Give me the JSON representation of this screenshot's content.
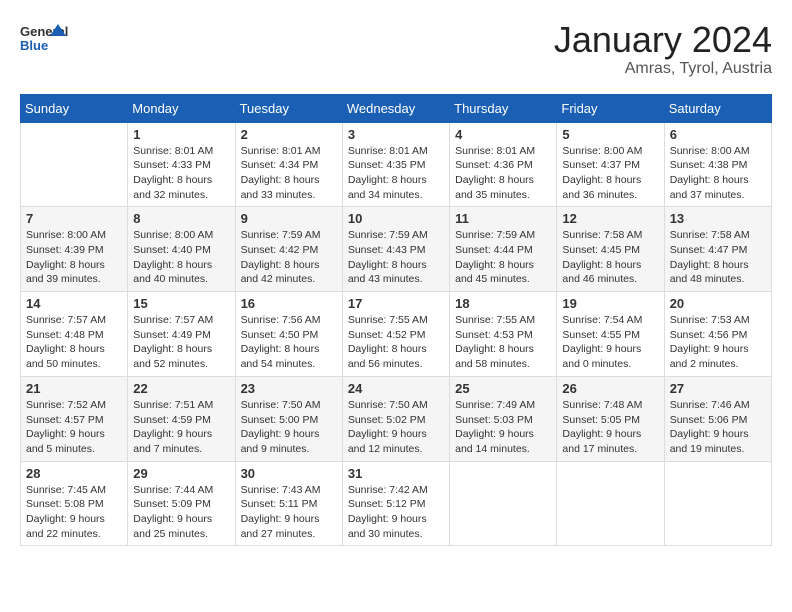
{
  "header": {
    "logo_general": "General",
    "logo_blue": "Blue",
    "title": "January 2024",
    "location": "Amras, Tyrol, Austria"
  },
  "weekdays": [
    "Sunday",
    "Monday",
    "Tuesday",
    "Wednesday",
    "Thursday",
    "Friday",
    "Saturday"
  ],
  "weeks": [
    [
      {
        "day": "",
        "info": ""
      },
      {
        "day": "1",
        "info": "Sunrise: 8:01 AM\nSunset: 4:33 PM\nDaylight: 8 hours\nand 32 minutes."
      },
      {
        "day": "2",
        "info": "Sunrise: 8:01 AM\nSunset: 4:34 PM\nDaylight: 8 hours\nand 33 minutes."
      },
      {
        "day": "3",
        "info": "Sunrise: 8:01 AM\nSunset: 4:35 PM\nDaylight: 8 hours\nand 34 minutes."
      },
      {
        "day": "4",
        "info": "Sunrise: 8:01 AM\nSunset: 4:36 PM\nDaylight: 8 hours\nand 35 minutes."
      },
      {
        "day": "5",
        "info": "Sunrise: 8:00 AM\nSunset: 4:37 PM\nDaylight: 8 hours\nand 36 minutes."
      },
      {
        "day": "6",
        "info": "Sunrise: 8:00 AM\nSunset: 4:38 PM\nDaylight: 8 hours\nand 37 minutes."
      }
    ],
    [
      {
        "day": "7",
        "info": "Sunrise: 8:00 AM\nSunset: 4:39 PM\nDaylight: 8 hours\nand 39 minutes."
      },
      {
        "day": "8",
        "info": "Sunrise: 8:00 AM\nSunset: 4:40 PM\nDaylight: 8 hours\nand 40 minutes."
      },
      {
        "day": "9",
        "info": "Sunrise: 7:59 AM\nSunset: 4:42 PM\nDaylight: 8 hours\nand 42 minutes."
      },
      {
        "day": "10",
        "info": "Sunrise: 7:59 AM\nSunset: 4:43 PM\nDaylight: 8 hours\nand 43 minutes."
      },
      {
        "day": "11",
        "info": "Sunrise: 7:59 AM\nSunset: 4:44 PM\nDaylight: 8 hours\nand 45 minutes."
      },
      {
        "day": "12",
        "info": "Sunrise: 7:58 AM\nSunset: 4:45 PM\nDaylight: 8 hours\nand 46 minutes."
      },
      {
        "day": "13",
        "info": "Sunrise: 7:58 AM\nSunset: 4:47 PM\nDaylight: 8 hours\nand 48 minutes."
      }
    ],
    [
      {
        "day": "14",
        "info": "Sunrise: 7:57 AM\nSunset: 4:48 PM\nDaylight: 8 hours\nand 50 minutes."
      },
      {
        "day": "15",
        "info": "Sunrise: 7:57 AM\nSunset: 4:49 PM\nDaylight: 8 hours\nand 52 minutes."
      },
      {
        "day": "16",
        "info": "Sunrise: 7:56 AM\nSunset: 4:50 PM\nDaylight: 8 hours\nand 54 minutes."
      },
      {
        "day": "17",
        "info": "Sunrise: 7:55 AM\nSunset: 4:52 PM\nDaylight: 8 hours\nand 56 minutes."
      },
      {
        "day": "18",
        "info": "Sunrise: 7:55 AM\nSunset: 4:53 PM\nDaylight: 8 hours\nand 58 minutes."
      },
      {
        "day": "19",
        "info": "Sunrise: 7:54 AM\nSunset: 4:55 PM\nDaylight: 9 hours\nand 0 minutes."
      },
      {
        "day": "20",
        "info": "Sunrise: 7:53 AM\nSunset: 4:56 PM\nDaylight: 9 hours\nand 2 minutes."
      }
    ],
    [
      {
        "day": "21",
        "info": "Sunrise: 7:52 AM\nSunset: 4:57 PM\nDaylight: 9 hours\nand 5 minutes."
      },
      {
        "day": "22",
        "info": "Sunrise: 7:51 AM\nSunset: 4:59 PM\nDaylight: 9 hours\nand 7 minutes."
      },
      {
        "day": "23",
        "info": "Sunrise: 7:50 AM\nSunset: 5:00 PM\nDaylight: 9 hours\nand 9 minutes."
      },
      {
        "day": "24",
        "info": "Sunrise: 7:50 AM\nSunset: 5:02 PM\nDaylight: 9 hours\nand 12 minutes."
      },
      {
        "day": "25",
        "info": "Sunrise: 7:49 AM\nSunset: 5:03 PM\nDaylight: 9 hours\nand 14 minutes."
      },
      {
        "day": "26",
        "info": "Sunrise: 7:48 AM\nSunset: 5:05 PM\nDaylight: 9 hours\nand 17 minutes."
      },
      {
        "day": "27",
        "info": "Sunrise: 7:46 AM\nSunset: 5:06 PM\nDaylight: 9 hours\nand 19 minutes."
      }
    ],
    [
      {
        "day": "28",
        "info": "Sunrise: 7:45 AM\nSunset: 5:08 PM\nDaylight: 9 hours\nand 22 minutes."
      },
      {
        "day": "29",
        "info": "Sunrise: 7:44 AM\nSunset: 5:09 PM\nDaylight: 9 hours\nand 25 minutes."
      },
      {
        "day": "30",
        "info": "Sunrise: 7:43 AM\nSunset: 5:11 PM\nDaylight: 9 hours\nand 27 minutes."
      },
      {
        "day": "31",
        "info": "Sunrise: 7:42 AM\nSunset: 5:12 PM\nDaylight: 9 hours\nand 30 minutes."
      },
      {
        "day": "",
        "info": ""
      },
      {
        "day": "",
        "info": ""
      },
      {
        "day": "",
        "info": ""
      }
    ]
  ]
}
